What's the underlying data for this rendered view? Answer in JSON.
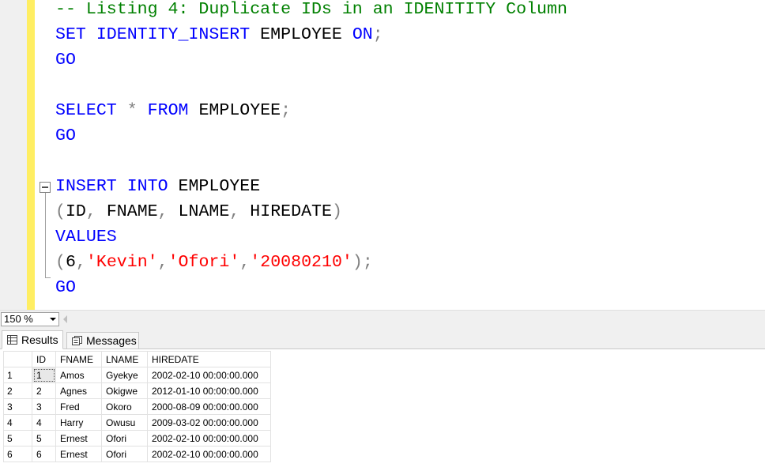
{
  "editor": {
    "lines": [
      [
        {
          "t": "-- Listing 4: Duplicate IDs in an IDENITITY Column",
          "c": "cm"
        }
      ],
      [
        {
          "t": "SET IDENTITY_INSERT",
          "c": "kw"
        },
        {
          "t": " EMPLOYEE ",
          "c": ""
        },
        {
          "t": "ON",
          "c": "kw"
        },
        {
          "t": ";",
          "c": "op"
        }
      ],
      [
        {
          "t": "GO",
          "c": "kw"
        }
      ],
      [],
      [
        {
          "t": "SELECT",
          "c": "kw"
        },
        {
          "t": " ",
          "c": ""
        },
        {
          "t": "*",
          "c": "op"
        },
        {
          "t": " ",
          "c": ""
        },
        {
          "t": "FROM",
          "c": "kw"
        },
        {
          "t": " EMPLOYEE",
          "c": ""
        },
        {
          "t": ";",
          "c": "op"
        }
      ],
      [
        {
          "t": "GO",
          "c": "kw"
        }
      ],
      [],
      [
        {
          "t": "INSERT INTO",
          "c": "kw"
        },
        {
          "t": " EMPLOYEE",
          "c": ""
        }
      ],
      [
        {
          "t": "(",
          "c": "op"
        },
        {
          "t": "ID",
          "c": ""
        },
        {
          "t": ",",
          "c": "op"
        },
        {
          "t": " FNAME",
          "c": ""
        },
        {
          "t": ",",
          "c": "op"
        },
        {
          "t": " LNAME",
          "c": ""
        },
        {
          "t": ",",
          "c": "op"
        },
        {
          "t": " HIREDATE",
          "c": ""
        },
        {
          "t": ")",
          "c": "op"
        }
      ],
      [
        {
          "t": "VALUES",
          "c": "kw"
        }
      ],
      [
        {
          "t": "(",
          "c": "op"
        },
        {
          "t": "6",
          "c": ""
        },
        {
          "t": ",",
          "c": "op"
        },
        {
          "t": "'Kevin'",
          "c": "st"
        },
        {
          "t": ",",
          "c": "op"
        },
        {
          "t": "'Ofori'",
          "c": "st"
        },
        {
          "t": ",",
          "c": "op"
        },
        {
          "t": "'20080210'",
          "c": "st"
        },
        {
          "t": ");",
          "c": "op"
        }
      ],
      [
        {
          "t": "GO",
          "c": "kw"
        }
      ]
    ]
  },
  "zoom": {
    "value": "150 %"
  },
  "tabs": {
    "results_label": "Results",
    "messages_label": "Messages"
  },
  "grid": {
    "columns": [
      "ID",
      "FNAME",
      "LNAME",
      "HIREDATE"
    ],
    "rows": [
      {
        "n": "1",
        "cells": [
          "1",
          "Amos",
          "Gyekye",
          "2002-02-10 00:00:00.000"
        ]
      },
      {
        "n": "2",
        "cells": [
          "2",
          "Agnes",
          "Okigwe",
          "2012-01-10 00:00:00.000"
        ]
      },
      {
        "n": "3",
        "cells": [
          "3",
          "Fred",
          "Okoro",
          "2000-08-09 00:00:00.000"
        ]
      },
      {
        "n": "4",
        "cells": [
          "4",
          "Harry",
          "Owusu",
          "2009-03-02 00:00:00.000"
        ]
      },
      {
        "n": "5",
        "cells": [
          "5",
          "Ernest",
          "Ofori",
          "2002-02-10 00:00:00.000"
        ]
      },
      {
        "n": "6",
        "cells": [
          "6",
          "Ernest",
          "Ofori",
          "2002-02-10 00:00:00.000"
        ]
      }
    ]
  },
  "colors": {
    "keyword": "#0000ff",
    "comment": "#008000",
    "string": "#ff0000",
    "operator": "#808080",
    "margin": "#ffee62"
  }
}
